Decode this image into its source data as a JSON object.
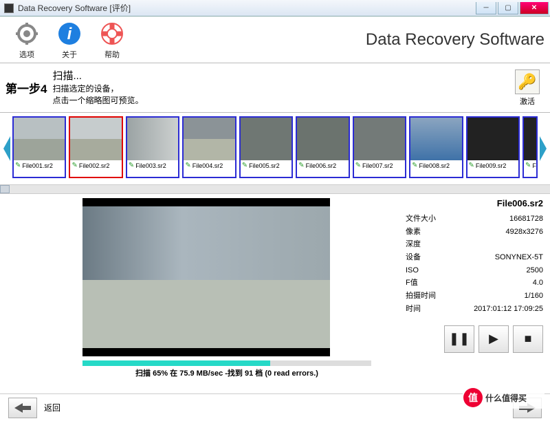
{
  "window": {
    "title": "Data Recovery Software [评价]"
  },
  "toolbar": {
    "options": "选项",
    "about": "关于",
    "help": "帮助",
    "app_title": "Data Recovery Software"
  },
  "step": {
    "label": "第一步4",
    "heading": "扫描...",
    "line1": "扫描选定的设备，",
    "line2": "点击一个缩略图可预览。",
    "activate": "激活"
  },
  "thumbs": [
    {
      "name": "File001.sr2",
      "cls": "a"
    },
    {
      "name": "File002.sr2",
      "cls": "b"
    },
    {
      "name": "File003.sr2",
      "cls": "c"
    },
    {
      "name": "File004.sr2",
      "cls": "d"
    },
    {
      "name": "File005.sr2",
      "cls": "e"
    },
    {
      "name": "File006.sr2",
      "cls": "f"
    },
    {
      "name": "File007.sr2",
      "cls": "g"
    },
    {
      "name": "File008.sr2",
      "cls": "h"
    },
    {
      "name": "File009.sr2",
      "cls": "i"
    }
  ],
  "selected_index": 1,
  "progress": {
    "percent": 65,
    "text": "扫描 65% 在 75.9 MB/sec -找到 91 档 (0 read errors.)"
  },
  "meta": {
    "filename": "File006.sr2",
    "rows": [
      {
        "k": "文件大小",
        "v": "16681728"
      },
      {
        "k": "像素",
        "v": "4928x3276"
      },
      {
        "k": "深度",
        "v": ""
      },
      {
        "k": "设备",
        "v": "SONYNEX-5T"
      },
      {
        "k": "ISO",
        "v": "2500"
      },
      {
        "k": "F值",
        "v": "4.0"
      },
      {
        "k": "拍摄时间",
        "v": "1/160"
      },
      {
        "k": "时间",
        "v": "2017:01:12 17:09:25"
      }
    ]
  },
  "footer": {
    "back": "返回"
  },
  "watermark": "什么值得买"
}
